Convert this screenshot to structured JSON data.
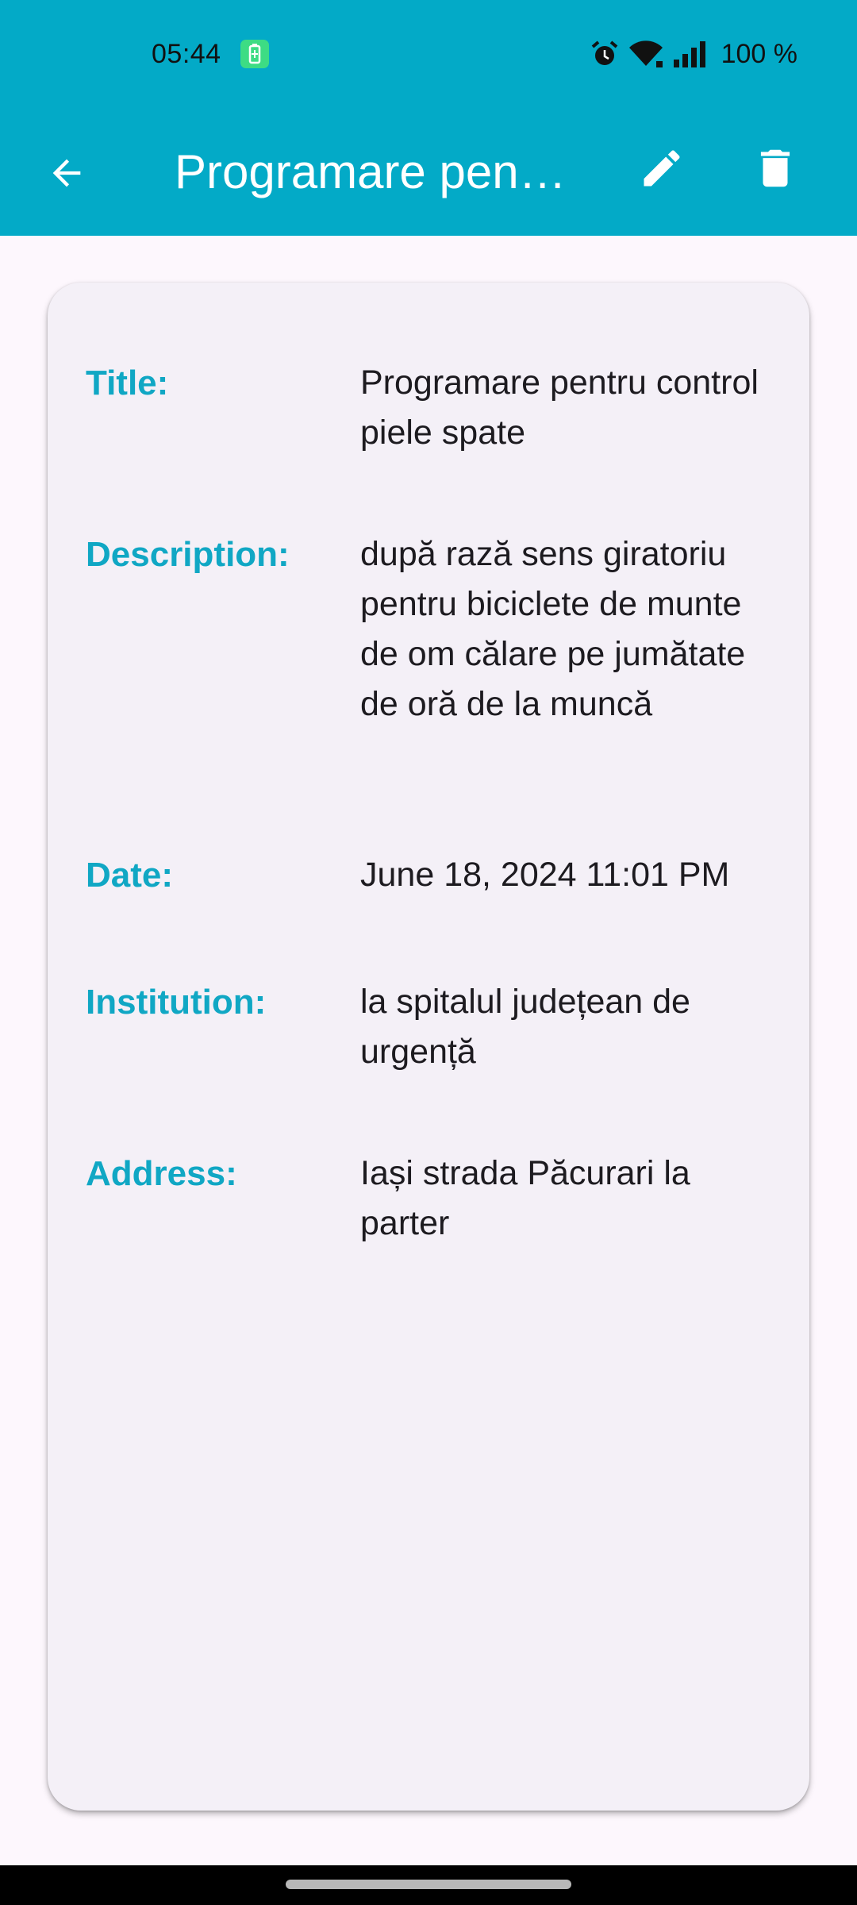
{
  "status_bar": {
    "time": "05:44",
    "battery_percent": "100 %",
    "icons": [
      "battery-saver-icon",
      "alarm-icon",
      "wifi-icon",
      "signal-icon"
    ]
  },
  "app_bar": {
    "title": "Programare pentru control piele spate",
    "back_icon": "arrow-back-icon",
    "edit_icon": "pencil-icon",
    "delete_icon": "trash-icon",
    "background_color": "#03aac7"
  },
  "details": {
    "title_label": "Title:",
    "title_value": "Programare pentru control piele spate",
    "description_label": "Description:",
    "description_value": "după rază sens giratoriu pentru biciclete de munte de om călare pe jumătate de oră de la muncă",
    "date_label": "Date:",
    "date_value": "June 18, 2024 11:01 PM",
    "institution_label": "Institution:",
    "institution_value": "la spitalul județean de urgență",
    "address_label": "Address:",
    "address_value": "Iași strada Păcurari la parter"
  },
  "colors": {
    "accent": "#03aac7",
    "label_color": "#10a7c4",
    "card_background": "#f4f0f7",
    "page_background": "#fdf7fd"
  }
}
